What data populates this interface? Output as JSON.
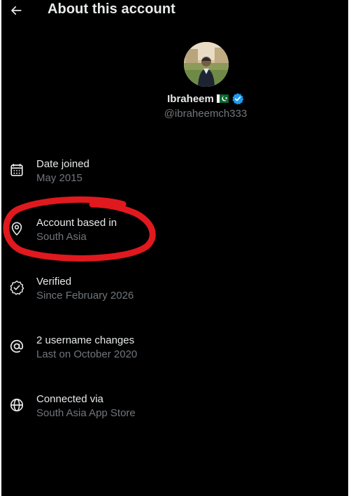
{
  "header": {
    "title": "About this account",
    "back_icon": "arrow-left-icon"
  },
  "profile": {
    "name": "Ibraheem",
    "flag_icon": "pakistan-flag-icon",
    "verified_icon": "verified-badge-icon",
    "verified_color": "#1d9bf0",
    "handle": "@ibraheemch333"
  },
  "rows": [
    {
      "title": "Date joined",
      "value": "May 2015",
      "icon": "calendar-icon"
    },
    {
      "title": "Account based in",
      "value": "South Asia",
      "icon": "location-pin-icon"
    },
    {
      "title": "Verified",
      "value": "Since February 2026",
      "icon": "verified-check-icon"
    },
    {
      "title": "2 username changes",
      "value": "Last on October 2020",
      "icon": "at-sign-icon"
    },
    {
      "title": "Connected via",
      "value": "South Asia App Store",
      "icon": "globe-icon"
    }
  ],
  "colors": {
    "background": "#000000",
    "text": "#e7e9ea",
    "muted": "#71767b",
    "annotation": "#e0191f"
  }
}
